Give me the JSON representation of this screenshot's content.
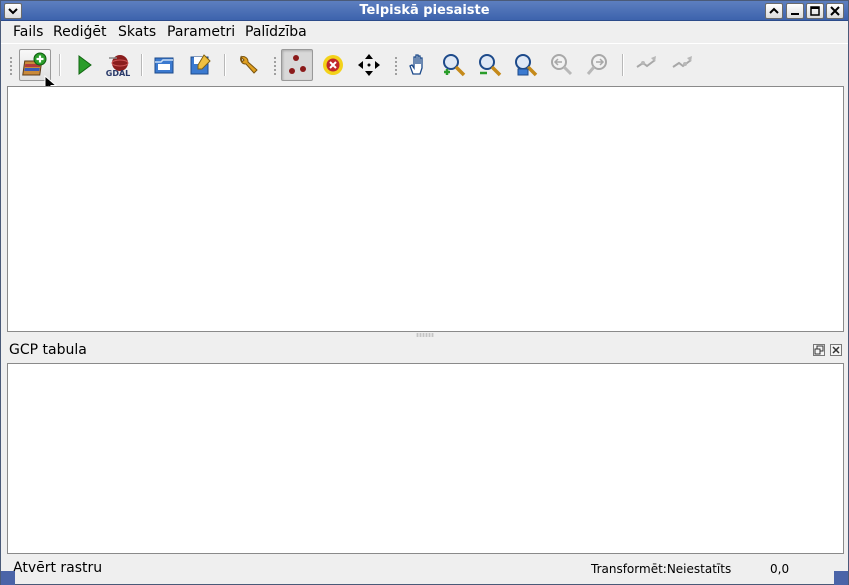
{
  "window": {
    "title": "Telpiskā piesaiste",
    "controls": [
      "shade-up",
      "minimize",
      "maximize",
      "close"
    ]
  },
  "menu": {
    "items": [
      "Fails",
      "Rediģēt",
      "Skats",
      "Parametri",
      "Palīdzība"
    ]
  },
  "toolbar": {
    "buttons": [
      {
        "name": "open-raster",
        "icon": "open-raster-icon",
        "state": "hover"
      },
      {
        "name": "start-georeferencing",
        "icon": "play-icon"
      },
      {
        "name": "generate-gdal-script",
        "icon": "gdal-icon",
        "icon_text": "GDAL"
      },
      {
        "name": "load-gcp-points",
        "icon": "folder-open-icon"
      },
      {
        "name": "save-gcp-points",
        "icon": "save-icon"
      },
      {
        "name": "transformation-settings",
        "icon": "wrench-icon"
      },
      {
        "name": "add-point",
        "icon": "add-point-icon",
        "state": "pressed"
      },
      {
        "name": "delete-point",
        "icon": "delete-point-icon"
      },
      {
        "name": "move-gcp-point",
        "icon": "move-icon"
      },
      {
        "name": "pan",
        "icon": "hand-icon"
      },
      {
        "name": "zoom-in",
        "icon": "zoom-in-icon"
      },
      {
        "name": "zoom-out",
        "icon": "zoom-out-icon"
      },
      {
        "name": "zoom-to-layer",
        "icon": "zoom-layer-icon"
      },
      {
        "name": "zoom-last",
        "icon": "zoom-last-icon",
        "state": "disabled"
      },
      {
        "name": "zoom-next",
        "icon": "zoom-next-icon",
        "state": "disabled"
      },
      {
        "name": "link-georeferencer-to-qgis",
        "icon": "link-geo-icon",
        "state": "disabled"
      },
      {
        "name": "link-qgis-to-georeferencer",
        "icon": "link-qgis-icon",
        "state": "disabled"
      }
    ]
  },
  "dock": {
    "title": "GCP tabula"
  },
  "status": {
    "message": "Atvērt rastru",
    "transform": "Transformēt:Neiestatīts",
    "coords": "0,0"
  },
  "colors": {
    "titlebar": "#4a6fb8",
    "background": "#efefef",
    "accent_red": "#c0282c",
    "accent_green": "#2a9d2a"
  }
}
